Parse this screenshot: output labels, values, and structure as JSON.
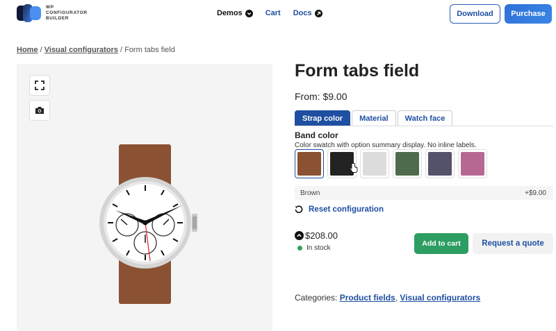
{
  "header": {
    "logo_text_line1": "WP",
    "logo_text_line2": "CONFIGURATOR",
    "logo_text_line3": "BUILDER",
    "nav": [
      {
        "label": "Demos",
        "icon": "chevron-down-icon"
      },
      {
        "label": "Cart"
      },
      {
        "label": "Docs",
        "icon": "arrow-up-right-icon"
      }
    ],
    "download_label": "Download",
    "purchase_label": "Purchase"
  },
  "breadcrumb": {
    "home": "Home",
    "sep": "/",
    "parent": "Visual configurators",
    "current": "Form tabs field"
  },
  "product": {
    "title": "Form tabs field",
    "price_from": "From: $9.00",
    "tabs": [
      {
        "label": "Strap color",
        "active": true
      },
      {
        "label": "Material",
        "active": false
      },
      {
        "label": "Watch face",
        "active": false
      }
    ],
    "field_title": "Band color",
    "field_desc": "Color swatch with option summary display. No inline labels.",
    "swatches": [
      {
        "color": "#8a5132",
        "selected": true
      },
      {
        "color": "#222222",
        "selected": false
      },
      {
        "color": "#dcdcdc",
        "selected": false
      },
      {
        "color": "#4f6b4e",
        "selected": false
      },
      {
        "color": "#55526b",
        "selected": false
      },
      {
        "color": "#b76892",
        "selected": false
      }
    ],
    "summary_name": "Brown",
    "summary_price": "+$9.00",
    "reset_label": "Reset configuration",
    "total_price": "$208.00",
    "stock_label": "In stock",
    "add_to_cart_label": "Add to cart",
    "quote_label": "Request a quote",
    "categories_label": "Categories:",
    "categories": [
      "Product fields",
      "Visual configurators"
    ],
    "categories_sep": ","
  },
  "colors": {
    "accent": "#1e4fa1",
    "cart_green": "#2e9d62",
    "strap_brown": "#8a5132"
  }
}
